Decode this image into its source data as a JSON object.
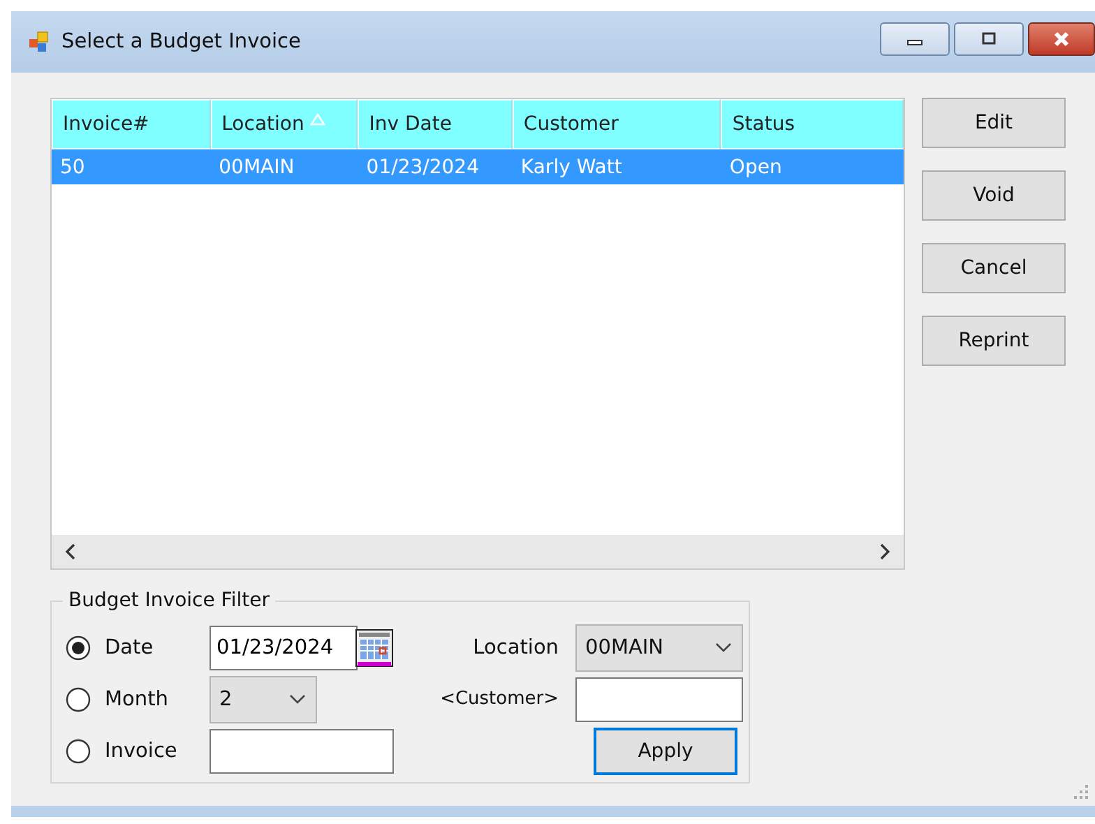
{
  "window": {
    "title": "Select a Budget Invoice"
  },
  "table": {
    "columns": [
      {
        "label": "Invoice#",
        "sorted": false
      },
      {
        "label": "Location",
        "sorted": true
      },
      {
        "label": "Inv Date",
        "sorted": false
      },
      {
        "label": "Customer",
        "sorted": false
      },
      {
        "label": "Status",
        "sorted": false
      }
    ],
    "rows": [
      {
        "cells": [
          "50",
          "00MAIN",
          "01/23/2024",
          "Karly Watt",
          "Open"
        ],
        "selected": true
      }
    ]
  },
  "buttons": [
    "Edit",
    "Void",
    "Cancel",
    "Reprint"
  ],
  "filter": {
    "title": "Budget Invoice Filter",
    "modes": [
      {
        "label": "Date",
        "selected": true
      },
      {
        "label": "Month",
        "selected": false
      },
      {
        "label": "Invoice",
        "selected": false
      }
    ],
    "date": "01/23/2024",
    "month": "2",
    "location": {
      "label": "Location",
      "value": "00MAIN"
    },
    "customer": {
      "label": "<Customer>"
    },
    "apply": "Apply"
  }
}
